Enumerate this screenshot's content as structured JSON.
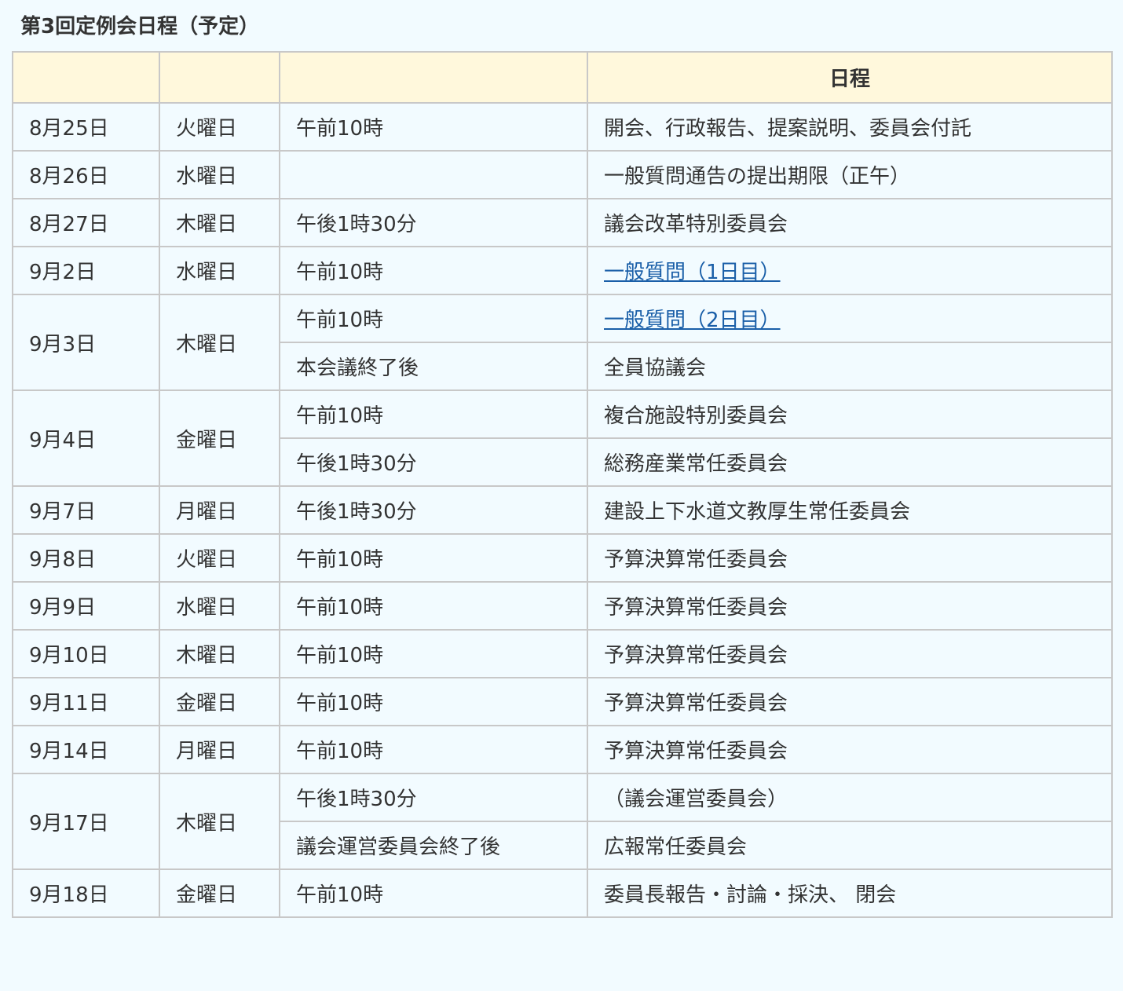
{
  "title": "第3回定例会日程（予定）",
  "header": {
    "date": "",
    "weekday": "",
    "time": "",
    "schedule": "日程"
  },
  "rows": [
    {
      "date": "8月25日",
      "weekday": "火曜日",
      "entries": [
        {
          "time": "午前10時",
          "schedule": "開会、行政報告、提案説明、委員会付託"
        }
      ]
    },
    {
      "date": "8月26日",
      "weekday": "水曜日",
      "entries": [
        {
          "time": "",
          "schedule": "一般質問通告の提出期限（正午）"
        }
      ]
    },
    {
      "date": "8月27日",
      "weekday": "木曜日",
      "entries": [
        {
          "time": "午後1時30分",
          "schedule": "議会改革特別委員会"
        }
      ]
    },
    {
      "date": "9月2日",
      "weekday": "水曜日",
      "entries": [
        {
          "time": "午前10時",
          "schedule": "一般質問（1日目）",
          "link": true
        }
      ]
    },
    {
      "date": "9月3日",
      "weekday": "木曜日",
      "entries": [
        {
          "time": "午前10時",
          "schedule": "一般質問（2日目）",
          "link": true
        },
        {
          "time": "本会議終了後",
          "schedule": "全員協議会"
        }
      ]
    },
    {
      "date": "9月4日",
      "weekday": "金曜日",
      "entries": [
        {
          "time": "午前10時",
          "schedule": "複合施設特別委員会"
        },
        {
          "time": "午後1時30分",
          "schedule": "総務産業常任委員会"
        }
      ]
    },
    {
      "date": "9月7日",
      "weekday": "月曜日",
      "entries": [
        {
          "time": "午後1時30分",
          "schedule": "建設上下水道文教厚生常任委員会"
        }
      ]
    },
    {
      "date": "9月8日",
      "weekday": "火曜日",
      "entries": [
        {
          "time": "午前10時",
          "schedule": "予算決算常任委員会"
        }
      ]
    },
    {
      "date": "9月9日",
      "weekday": "水曜日",
      "entries": [
        {
          "time": "午前10時",
          "schedule": "予算決算常任委員会"
        }
      ]
    },
    {
      "date": "9月10日",
      "weekday": "木曜日",
      "entries": [
        {
          "time": "午前10時",
          "schedule": "予算決算常任委員会"
        }
      ]
    },
    {
      "date": "9月11日",
      "weekday": "金曜日",
      "entries": [
        {
          "time": "午前10時",
          "schedule": "予算決算常任委員会"
        }
      ]
    },
    {
      "date": "9月14日",
      "weekday": "月曜日",
      "entries": [
        {
          "time": "午前10時",
          "schedule": "予算決算常任委員会"
        }
      ]
    },
    {
      "date": "9月17日",
      "weekday": "木曜日",
      "entries": [
        {
          "time": "午後1時30分",
          "schedule": "（議会運営委員会）"
        },
        {
          "time": "議会運営委員会終了後",
          "schedule": "広報常任委員会"
        }
      ]
    },
    {
      "date": "9月18日",
      "weekday": "金曜日",
      "entries": [
        {
          "time": "午前10時",
          "schedule": "委員長報告・討論・採決、 閉会"
        }
      ]
    }
  ]
}
